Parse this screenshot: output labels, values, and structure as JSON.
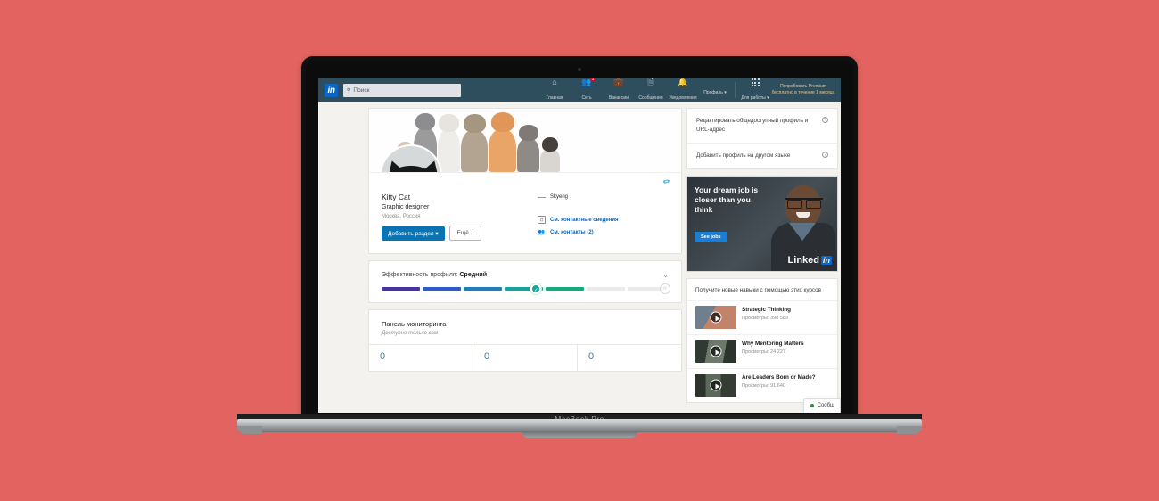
{
  "device": {
    "label": "MacBook Pro"
  },
  "colors": {
    "background": "#e2635f",
    "navbar": "#2e4e5e",
    "brand_blue": "#0a66c2",
    "button_blue": "#0a74b3",
    "premium_gold": "#e7c78a",
    "badge_red": "#cb112d",
    "stat_blue": "#4b7a94",
    "online_green": "#2b8a3e"
  },
  "navbar": {
    "logo": "in",
    "search": {
      "placeholder": "Поиск",
      "value": "",
      "icon": "search-icon"
    },
    "items": [
      {
        "label": "Главная",
        "icon": "home-icon",
        "badge": ""
      },
      {
        "label": "Сеть",
        "icon": "network-icon",
        "badge": "1"
      },
      {
        "label": "Вакансии",
        "icon": "briefcase-icon",
        "badge": ""
      },
      {
        "label": "Сообщения",
        "icon": "messages-icon",
        "badge": ""
      },
      {
        "label": "Уведомления",
        "icon": "bell-icon",
        "badge": ""
      },
      {
        "label": "Профиль ▾",
        "icon": "avatar-icon",
        "badge": ""
      },
      {
        "label": "Для работы ▾",
        "icon": "grid-icon",
        "badge": ""
      }
    ],
    "premium": "Попробовать Premium бесплатно в течение 1 месяца"
  },
  "profile": {
    "edit_icon": "pencil-icon",
    "name": "Kitty Cat",
    "headline": "Graphic designer",
    "location": "Москва, Россия",
    "add_section_button": "Добавить раздел ▾",
    "more_button": "Ещё...",
    "company": "Skyeng",
    "contact_info_link": "См. контактные сведения",
    "connections_link": "См. контакты (2)"
  },
  "strength": {
    "label": "Эффективность профиля:",
    "level": "Средний",
    "chevron": "⌄",
    "star_icon": "star-icon",
    "check_icon": "check-icon",
    "segments": [
      {
        "color": "#4733a8"
      },
      {
        "color": "#2f5bc4"
      },
      {
        "color": "#1f7fb8"
      },
      {
        "color": "#18a39a"
      },
      {
        "color": "#17a97f"
      },
      {
        "color": "#e8eaec"
      },
      {
        "color": "#e8eaec"
      }
    ],
    "filled_count": 5
  },
  "dashboard": {
    "title": "Панель мониторинга",
    "subtitle": "Доступно только вам",
    "stats": [
      {
        "value": "0"
      },
      {
        "value": "0"
      },
      {
        "value": "0"
      }
    ]
  },
  "sidebar": {
    "links": [
      {
        "label": "Редактировать общедоступный профиль и URL-адрес",
        "icon": "help-icon"
      },
      {
        "label": "Добавить профиль на другом языке",
        "icon": "help-icon"
      }
    ],
    "ad": {
      "headline": "Your dream job is closer than you think",
      "button": "See jobs",
      "logo": "Linked",
      "logo_box": "in"
    },
    "courses_header": "Получите новые навыки с помощью этих курсов",
    "courses": [
      {
        "title": "Strategic Thinking",
        "views": "Просмотры: 398 589",
        "thumb": "#c2836a",
        "play": "play-icon"
      },
      {
        "title": "Why Mentoring Matters",
        "views": "Просмотры: 24 227",
        "thumb": "#4a5348",
        "play": "play-icon"
      },
      {
        "title": "Are Leaders Born or Made?",
        "views": "Просмотры: 91 640",
        "thumb": "#3d4a40",
        "play": "play-icon"
      }
    ]
  },
  "messaging_chip": {
    "label": "Сообщ",
    "status_icon": "online-dot"
  }
}
